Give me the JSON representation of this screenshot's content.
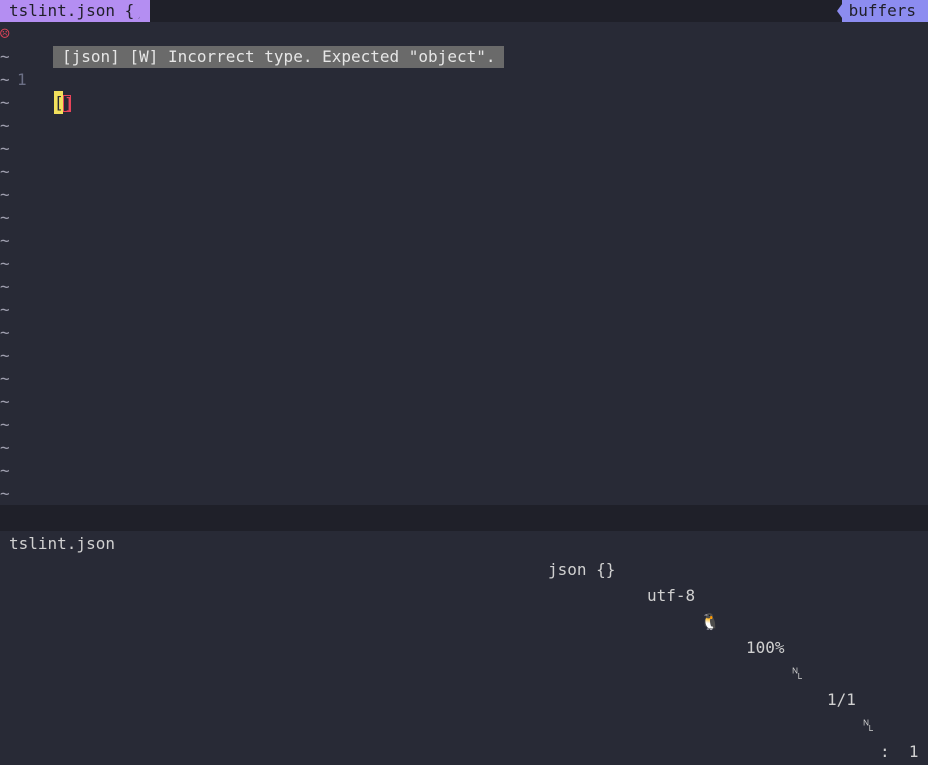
{
  "tabline": {
    "active_tab": "tslint.json {}",
    "buffers_label": "buffers"
  },
  "editor": {
    "sign_icon": "☹",
    "line_number": "1",
    "line_text_open": "[",
    "line_text_close": "]",
    "diagnostic": "[json] [W] Incorrect type. Expected \"object\".",
    "empty_marker": "~"
  },
  "statusline": {
    "filename": "tslint.json",
    "filetype": "json {}",
    "encoding": "utf-8",
    "os_icon": "🐧",
    "percent": "100%",
    "line_icon_1": "␤",
    "position": "1/1",
    "line_icon_2": "␤",
    "column": ":  1"
  },
  "colors": {
    "background": "#282a36",
    "tab_active": "#b48ef2",
    "buffers": "#8c8cf0",
    "error": "#e8455a",
    "cursor": "#f2e05c",
    "diagnostic_bg": "#6a6a6a"
  }
}
